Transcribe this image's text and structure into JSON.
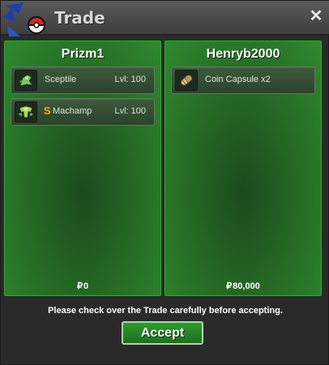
{
  "window": {
    "title": "Trade",
    "close_label": "✕"
  },
  "left_trader": {
    "name": "Prizm1",
    "items": [
      {
        "name": "Sceptile",
        "level": "Lvl: 100",
        "shiny": false,
        "icon": "sceptile-icon"
      },
      {
        "name": "Machamp",
        "level": "Lvl: 100",
        "shiny": true,
        "shiny_mark": "S",
        "icon": "machamp-icon"
      }
    ],
    "money_symbol": "₽",
    "money": "0"
  },
  "right_trader": {
    "name": "Henryb2000",
    "items": [
      {
        "name": "Coin Capsule x2",
        "icon": "coin-capsule-icon"
      }
    ],
    "money_symbol": "₽",
    "money": "80,000"
  },
  "footer": {
    "note": "Please check over the Trade carefully before accepting.",
    "accept_label": "Accept"
  },
  "colors": {
    "panel_green": "#2a7a2a",
    "accept_green": "#2f9a2f",
    "shiny_gold": "#f2b52a"
  }
}
